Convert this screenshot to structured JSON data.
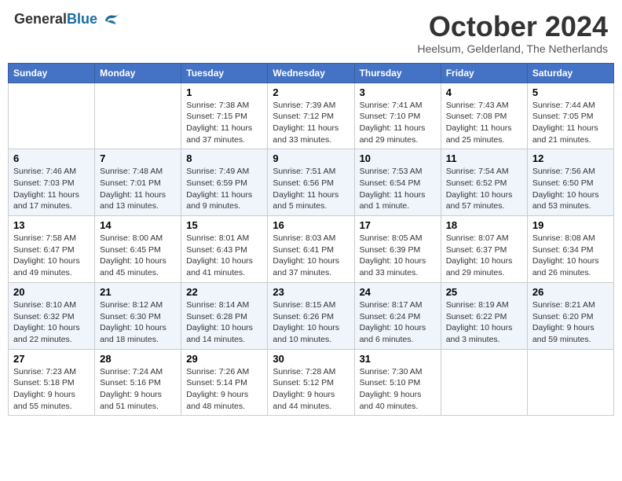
{
  "header": {
    "logo_general": "General",
    "logo_blue": "Blue",
    "month_title": "October 2024",
    "location": "Heelsum, Gelderland, The Netherlands"
  },
  "weekdays": [
    "Sunday",
    "Monday",
    "Tuesday",
    "Wednesday",
    "Thursday",
    "Friday",
    "Saturday"
  ],
  "weeks": [
    [
      {
        "day": "",
        "info": ""
      },
      {
        "day": "",
        "info": ""
      },
      {
        "day": "1",
        "info": "Sunrise: 7:38 AM\nSunset: 7:15 PM\nDaylight: 11 hours and 37 minutes."
      },
      {
        "day": "2",
        "info": "Sunrise: 7:39 AM\nSunset: 7:12 PM\nDaylight: 11 hours and 33 minutes."
      },
      {
        "day": "3",
        "info": "Sunrise: 7:41 AM\nSunset: 7:10 PM\nDaylight: 11 hours and 29 minutes."
      },
      {
        "day": "4",
        "info": "Sunrise: 7:43 AM\nSunset: 7:08 PM\nDaylight: 11 hours and 25 minutes."
      },
      {
        "day": "5",
        "info": "Sunrise: 7:44 AM\nSunset: 7:05 PM\nDaylight: 11 hours and 21 minutes."
      }
    ],
    [
      {
        "day": "6",
        "info": "Sunrise: 7:46 AM\nSunset: 7:03 PM\nDaylight: 11 hours and 17 minutes."
      },
      {
        "day": "7",
        "info": "Sunrise: 7:48 AM\nSunset: 7:01 PM\nDaylight: 11 hours and 13 minutes."
      },
      {
        "day": "8",
        "info": "Sunrise: 7:49 AM\nSunset: 6:59 PM\nDaylight: 11 hours and 9 minutes."
      },
      {
        "day": "9",
        "info": "Sunrise: 7:51 AM\nSunset: 6:56 PM\nDaylight: 11 hours and 5 minutes."
      },
      {
        "day": "10",
        "info": "Sunrise: 7:53 AM\nSunset: 6:54 PM\nDaylight: 11 hours and 1 minute."
      },
      {
        "day": "11",
        "info": "Sunrise: 7:54 AM\nSunset: 6:52 PM\nDaylight: 10 hours and 57 minutes."
      },
      {
        "day": "12",
        "info": "Sunrise: 7:56 AM\nSunset: 6:50 PM\nDaylight: 10 hours and 53 minutes."
      }
    ],
    [
      {
        "day": "13",
        "info": "Sunrise: 7:58 AM\nSunset: 6:47 PM\nDaylight: 10 hours and 49 minutes."
      },
      {
        "day": "14",
        "info": "Sunrise: 8:00 AM\nSunset: 6:45 PM\nDaylight: 10 hours and 45 minutes."
      },
      {
        "day": "15",
        "info": "Sunrise: 8:01 AM\nSunset: 6:43 PM\nDaylight: 10 hours and 41 minutes."
      },
      {
        "day": "16",
        "info": "Sunrise: 8:03 AM\nSunset: 6:41 PM\nDaylight: 10 hours and 37 minutes."
      },
      {
        "day": "17",
        "info": "Sunrise: 8:05 AM\nSunset: 6:39 PM\nDaylight: 10 hours and 33 minutes."
      },
      {
        "day": "18",
        "info": "Sunrise: 8:07 AM\nSunset: 6:37 PM\nDaylight: 10 hours and 29 minutes."
      },
      {
        "day": "19",
        "info": "Sunrise: 8:08 AM\nSunset: 6:34 PM\nDaylight: 10 hours and 26 minutes."
      }
    ],
    [
      {
        "day": "20",
        "info": "Sunrise: 8:10 AM\nSunset: 6:32 PM\nDaylight: 10 hours and 22 minutes."
      },
      {
        "day": "21",
        "info": "Sunrise: 8:12 AM\nSunset: 6:30 PM\nDaylight: 10 hours and 18 minutes."
      },
      {
        "day": "22",
        "info": "Sunrise: 8:14 AM\nSunset: 6:28 PM\nDaylight: 10 hours and 14 minutes."
      },
      {
        "day": "23",
        "info": "Sunrise: 8:15 AM\nSunset: 6:26 PM\nDaylight: 10 hours and 10 minutes."
      },
      {
        "day": "24",
        "info": "Sunrise: 8:17 AM\nSunset: 6:24 PM\nDaylight: 10 hours and 6 minutes."
      },
      {
        "day": "25",
        "info": "Sunrise: 8:19 AM\nSunset: 6:22 PM\nDaylight: 10 hours and 3 minutes."
      },
      {
        "day": "26",
        "info": "Sunrise: 8:21 AM\nSunset: 6:20 PM\nDaylight: 9 hours and 59 minutes."
      }
    ],
    [
      {
        "day": "27",
        "info": "Sunrise: 7:23 AM\nSunset: 5:18 PM\nDaylight: 9 hours and 55 minutes."
      },
      {
        "day": "28",
        "info": "Sunrise: 7:24 AM\nSunset: 5:16 PM\nDaylight: 9 hours and 51 minutes."
      },
      {
        "day": "29",
        "info": "Sunrise: 7:26 AM\nSunset: 5:14 PM\nDaylight: 9 hours and 48 minutes."
      },
      {
        "day": "30",
        "info": "Sunrise: 7:28 AM\nSunset: 5:12 PM\nDaylight: 9 hours and 44 minutes."
      },
      {
        "day": "31",
        "info": "Sunrise: 7:30 AM\nSunset: 5:10 PM\nDaylight: 9 hours and 40 minutes."
      },
      {
        "day": "",
        "info": ""
      },
      {
        "day": "",
        "info": ""
      }
    ]
  ]
}
